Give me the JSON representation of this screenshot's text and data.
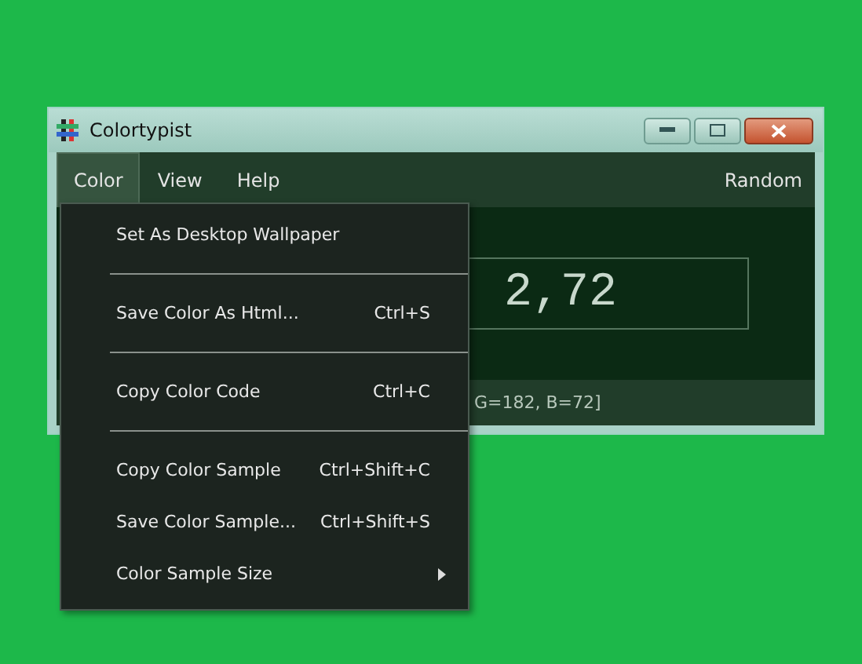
{
  "window": {
    "title": "Colortypist"
  },
  "menu_bar": [
    {
      "label": "Color",
      "selected": true
    },
    {
      "label": "View",
      "selected": false
    },
    {
      "label": "Help",
      "selected": false
    }
  ],
  "random_button": {
    "label": "Random"
  },
  "color_value": "2,72",
  "status_bar": "G=182, B=72]",
  "dropdown_menu": [
    {
      "kind": "item",
      "label": "Set As Desktop Wallpaper",
      "submenu": false
    },
    {
      "kind": "separator"
    },
    {
      "kind": "item",
      "label": "Save Color As Html...",
      "shortcut": "Ctrl+S",
      "submenu": false
    },
    {
      "kind": "separator"
    },
    {
      "kind": "item",
      "label": "Copy Color Code",
      "shortcut": "Ctrl+C",
      "submenu": false
    },
    {
      "kind": "separator"
    },
    {
      "kind": "item",
      "label": "Copy Color Sample",
      "shortcut": "Ctrl+Shift+C",
      "submenu": false
    },
    {
      "kind": "item",
      "label": "Save Color Sample...",
      "shortcut": "Ctrl+Shift+S",
      "submenu": false
    },
    {
      "kind": "item",
      "label": "Color Sample Size",
      "submenu": true
    }
  ]
}
